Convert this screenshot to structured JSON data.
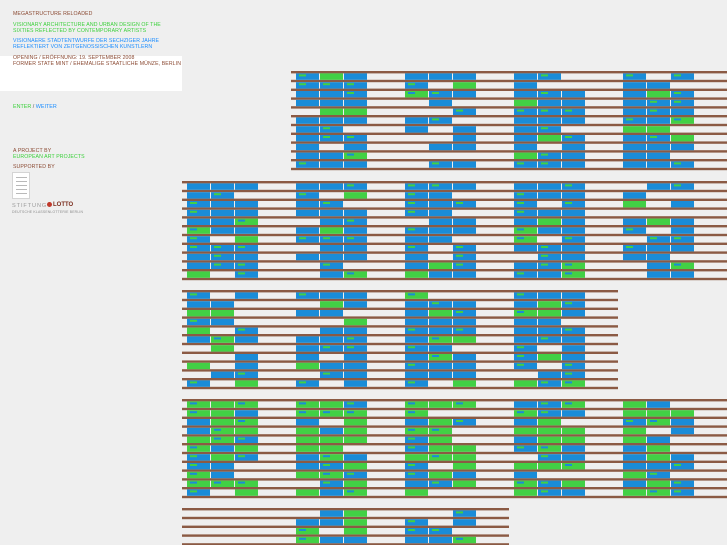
{
  "title": "MEGASTRUCTURE RELOADED",
  "subtitle_en": "VISIONARY ARCHITECTURE AND URBAN DESIGN OF THE SIXTIES REFLECTED BY CONTEMPORARY ARTISTS",
  "subtitle_de": "VISIONAERE STADTENTWURFE DER SECHZIGER JAHRE REFLEKTIERT VON ZEITGENOSSISCHEN KUNSTLERN",
  "opening": "OPENING / ERÖFFNUNG: 19. SEPTEMBER 2008",
  "venue": "FORMER STATE MINT / EHEMALIGE STAATLICHE MÜNZE, BERLIN",
  "enter_label": "ENTER",
  "separator": "/",
  "weiter_label": "WEITER",
  "project_label": "A PROJECT BY",
  "project_name": "EUROPEAN ART PROJECTS",
  "supported_label": "SUPPORTED BY",
  "stamp_label": "BUNDESKULTURSTIFTUNG",
  "logo": {
    "stiftung": "STIFTUNG",
    "lotto": "LOTTO",
    "sub": "DEUTSCHE KLASSENLOTTERIE BERLIN"
  },
  "colors": {
    "brown": "#8b4a33",
    "green": "#3ad03a",
    "blue": "#1a8cff",
    "block_blue": "#1a8cd8",
    "block_green": "#42d045",
    "line": "#8b5a44",
    "background": "#efefef"
  }
}
